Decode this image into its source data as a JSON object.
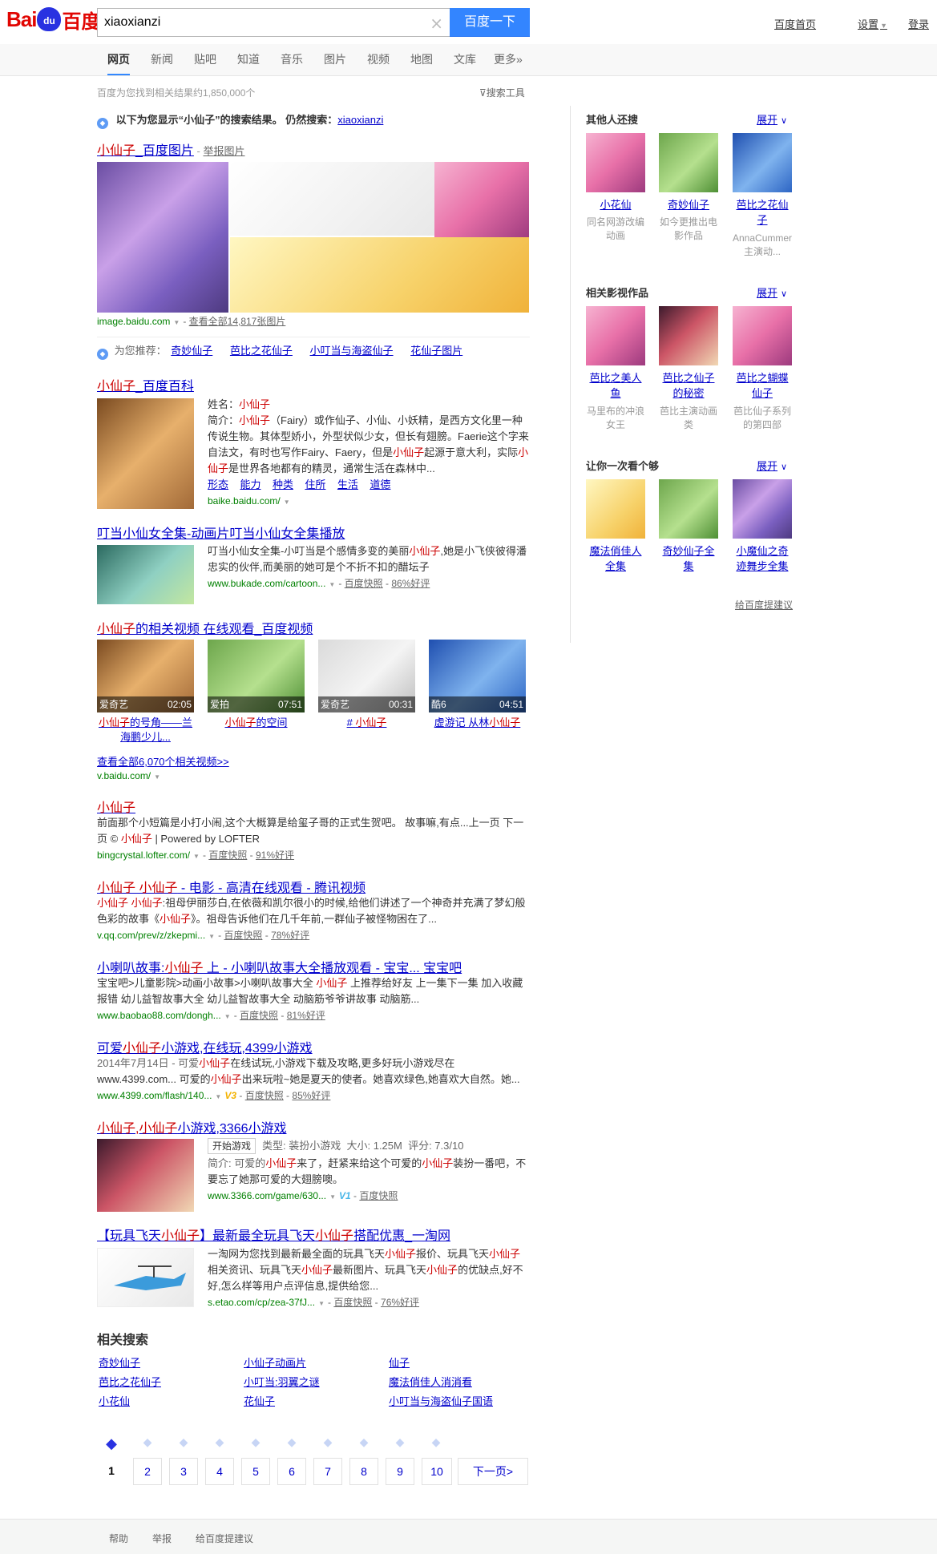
{
  "header": {
    "logo_left": "Bai",
    "logo_mid": "du",
    "logo_right": "百度",
    "search_value": "xiaoxianzi",
    "search_button": "百度一下",
    "links": [
      "百度首页",
      "设置",
      "登录"
    ]
  },
  "tabs": [
    "网页",
    "新闻",
    "贴吧",
    "知道",
    "音乐",
    "图片",
    "视频",
    "地图",
    "文库",
    "更多»"
  ],
  "stats": "百度为您找到相关结果约1,850,000个",
  "search_tools": "搜索工具",
  "correction": {
    "prefix": "以下为您显示“",
    "term": "小仙子",
    "suffix": "”的搜索结果。 仍然搜索：",
    "original": "xiaoxianzi"
  },
  "image_result": {
    "title_hl": "小仙子",
    "title_rest": "_百度图片",
    "report": "举报图片",
    "url": "image.baidu.com",
    "more": "查看全部14,817张图片",
    "recommend_label": "为您推荐：",
    "recommend": [
      "奇妙仙子",
      "芭比之花仙子",
      "小叮当与海盗仙子",
      "花仙子图片"
    ]
  },
  "baike": {
    "title_hl": "小仙子",
    "title_rest": "_百度百科",
    "name_label": "姓名：",
    "name": "小仙子",
    "intro_label": "简介：",
    "intro": [
      {
        "t": "小仙子",
        "h": true
      },
      {
        "t": "（Fairy）或作仙子、小仙、小妖精，是西方文化里一种传说生物。其体型娇小，外型状似少女，但长有翅膀。Faerie这个字来自法文，有时也写作Fairy、Faery，但是",
        "h": false
      },
      {
        "t": "小仙子",
        "h": true
      },
      {
        "t": "起源于意大利，实际",
        "h": false
      },
      {
        "t": "小仙子",
        "h": true
      },
      {
        "t": "是世界各地都有的精灵，通常生活在森林中...",
        "h": false
      }
    ],
    "links": [
      "形态",
      "能力",
      "种类",
      "住所",
      "生活",
      "道德"
    ],
    "url": "baike.baidu.com/"
  },
  "results": [
    {
      "title": [
        {
          "t": "叮当小仙女全集-动画片叮当小仙女全集播放",
          "h": false
        }
      ],
      "text": [
        {
          "t": "叮当小仙女全集-小叮当是个感情多变的美丽",
          "h": false
        },
        {
          "t": "小仙子",
          "h": true
        },
        {
          "t": ",她是小飞侠彼得潘忠实的伙伴,而美丽的她可是个不折不扣的醋坛子",
          "h": false
        }
      ],
      "url": "www.bukade.com/cartoon...",
      "extras": [
        "百度快照",
        "86%好评"
      ]
    }
  ],
  "video": {
    "title_hl": "小仙子",
    "title_rest": "的相关视频 在线观看_百度视频",
    "items": [
      {
        "source": "爱奇艺",
        "duration": "02:05",
        "title": [
          {
            "t": "小仙子",
            "h": true
          },
          {
            "t": "的号角——兰海鹏少儿...",
            "h": false
          }
        ]
      },
      {
        "source": "爱拍",
        "duration": "07:51",
        "title": [
          {
            "t": "小仙子",
            "h": true
          },
          {
            "t": "的空间",
            "h": false
          }
        ]
      },
      {
        "source": "爱奇艺",
        "duration": "00:31",
        "title": [
          {
            "t": "# ",
            "h": false
          },
          {
            "t": "小仙子",
            "h": true
          }
        ]
      },
      {
        "source": "酷6",
        "duration": "04:51",
        "title": [
          {
            "t": "虚游记 从林",
            "h": false
          },
          {
            "t": "小仙子",
            "h": true
          }
        ]
      }
    ],
    "all_link": "查看全部6,070个相关视频>>",
    "url": "v.baidu.com/"
  },
  "web_results": [
    {
      "title": [
        {
          "t": "小仙子",
          "h": true
        }
      ],
      "text": [
        {
          "t": "前面那个小短篇是小打小闹,这个大概算是给玺子哥的正式生贺吧。 故事嘛,有点...上一页 下一页 © ",
          "h": false
        },
        {
          "t": "小仙子",
          "h": true
        },
        {
          "t": " | Powered by LOFTER",
          "h": false
        }
      ],
      "url": "bingcrystal.lofter.com/",
      "extras": [
        "百度快照",
        "91%好评"
      ]
    },
    {
      "title": [
        {
          "t": "小仙子 小仙子",
          "h": true
        },
        {
          "t": " - 电影 - 高清在线观看 - 腾讯视频",
          "h": false
        }
      ],
      "text": [
        {
          "t": "小仙子 小仙子",
          "h": true
        },
        {
          "t": ":祖母伊丽莎白,在依薇和凯尔很小的时候,给他们讲述了一个神奇并充满了梦幻般色彩的故事《",
          "h": false
        },
        {
          "t": "小仙子",
          "h": true
        },
        {
          "t": "》。祖母告诉他们在几千年前,一群仙子被怪物困在了...",
          "h": false
        }
      ],
      "url": "v.qq.com/prev/z/zkepmi...",
      "extras": [
        "百度快照",
        "78%好评"
      ]
    },
    {
      "title": [
        {
          "t": "小喇叭故事:",
          "h": false
        },
        {
          "t": "小仙子",
          "h": true
        },
        {
          "t": " 上 - 小喇叭故事大全播放观看 - 宝宝... 宝宝吧",
          "h": false
        }
      ],
      "text": [
        {
          "t": "宝宝吧>儿童影院>动画小故事>小喇叭故事大全 ",
          "h": false
        },
        {
          "t": "小仙子",
          "h": true
        },
        {
          "t": " 上推荐给好友 上一集下一集 加入收藏报错 幼儿益智故事大全 幼儿益智故事大全 动脑筋爷爷讲故事 动脑筋...",
          "h": false
        }
      ],
      "url": "www.baobao88.com/dongh...",
      "extras": [
        "百度快照",
        "81%好评"
      ]
    },
    {
      "title": [
        {
          "t": "可爱",
          "h": false
        },
        {
          "t": "小仙子",
          "h": true
        },
        {
          "t": "小游戏,在线玩,4399小游戏",
          "h": false
        }
      ],
      "text": [
        {
          "t": "2014年7月14日 - 可爱",
          "h": false
        },
        {
          "t": "小仙子",
          "h": true
        },
        {
          "t": "在线试玩,小游戏下载及攻略,更多好玩小游戏尽在www.4399.com... 可爱的",
          "h": false
        },
        {
          "t": "小仙子",
          "h": true
        },
        {
          "t": "出来玩啦~她是夏天的使者。她喜欢绿色,她喜欢大自然。她...",
          "h": false
        }
      ],
      "url": "www.4399.com/flash/140...",
      "vbadge": "V3",
      "extras": [
        "百度快照",
        "85%好评"
      ]
    }
  ],
  "game_result": {
    "title": [
      {
        "t": "小仙子,小仙子",
        "h": true
      },
      {
        "t": "小游戏,3366小游戏",
        "h": false
      }
    ],
    "start_btn": "开始游戏",
    "meta": [
      "类型: 装扮小游戏",
      "大小: 1.25M",
      "评分: 7.3/10"
    ],
    "text": [
      {
        "t": "简介: 可爱的",
        "h": false
      },
      {
        "t": "小仙子",
        "h": true
      },
      {
        "t": "来了，赶紧来给这个可爱的",
        "h": false
      },
      {
        "t": "小仙子",
        "h": true
      },
      {
        "t": "装扮一番吧，不要忘了她那可爱的大翅膀噢。",
        "h": false
      }
    ],
    "url": "www.3366.com/game/630...",
    "vbadge": "V1",
    "extras": [
      "百度快照"
    ]
  },
  "etao_result": {
    "title": [
      {
        "t": "【玩具飞天",
        "h": false
      },
      {
        "t": "小仙子",
        "h": true
      },
      {
        "t": "】最新最全玩具飞天",
        "h": false
      },
      {
        "t": "小仙子",
        "h": true
      },
      {
        "t": "搭配优惠_一淘网",
        "h": false
      }
    ],
    "text": [
      {
        "t": "一淘网为您找到最新最全面的玩具飞天",
        "h": false
      },
      {
        "t": "小仙子",
        "h": true
      },
      {
        "t": "报价、玩具飞天",
        "h": false
      },
      {
        "t": "小仙子",
        "h": true
      },
      {
        "t": "相关资讯、玩具飞天",
        "h": false
      },
      {
        "t": "小仙子",
        "h": true
      },
      {
        "t": "最新图片、玩具飞天",
        "h": false
      },
      {
        "t": "小仙子",
        "h": true
      },
      {
        "t": "的优缺点,好不好,怎么样等用户点评信息,提供给您...",
        "h": false
      }
    ],
    "url": "s.etao.com/cp/zea-37fJ...",
    "extras": [
      "百度快照",
      "76%好评"
    ]
  },
  "related_search": {
    "heading": "相关搜索",
    "items": [
      "奇妙仙子",
      "小仙子动画片",
      "仙子",
      "芭比之花仙子",
      "小叮当:羽翼之谜",
      "魔法俏佳人消消看",
      "小花仙",
      "花仙子",
      "小叮当与海盗仙子国语"
    ]
  },
  "pager": {
    "pages": [
      "1",
      "2",
      "3",
      "4",
      "5",
      "6",
      "7",
      "8",
      "9",
      "10"
    ],
    "current": "1",
    "next": "下一页>"
  },
  "sidebar": {
    "sections": [
      {
        "heading": "其他人还搜",
        "expand": "展开",
        "items": [
          {
            "title": "小花仙",
            "sub": "同名网游改编动画"
          },
          {
            "title": "奇妙仙子",
            "sub": "如今更推出电影作品"
          },
          {
            "title": "芭比之花仙子",
            "sub": "AnnaCummer主演动..."
          }
        ]
      },
      {
        "heading": "相关影视作品",
        "expand": "展开",
        "items": [
          {
            "title": "芭比之美人鱼",
            "sub": "马里布的冲浪女王"
          },
          {
            "title": "芭比之仙子的秘密",
            "sub": "芭比主演动画类"
          },
          {
            "title": "芭比之蝴蝶仙子",
            "sub": "芭比仙子系列的第四部"
          }
        ]
      },
      {
        "heading": "让你一次看个够",
        "expand": "展开",
        "items": [
          {
            "title": "魔法俏佳人全集",
            "sub": ""
          },
          {
            "title": "奇妙仙子全集",
            "sub": ""
          },
          {
            "title": "小魔仙之奇迹舞步全集",
            "sub": ""
          }
        ]
      }
    ],
    "feedback": "给百度提建议"
  },
  "footer": [
    "帮助",
    "举报",
    "给百度提建议"
  ],
  "colors": {
    "accent": "#3385ff",
    "link": "#0000cc",
    "highlight": "#cc0000",
    "url": "#008000"
  }
}
